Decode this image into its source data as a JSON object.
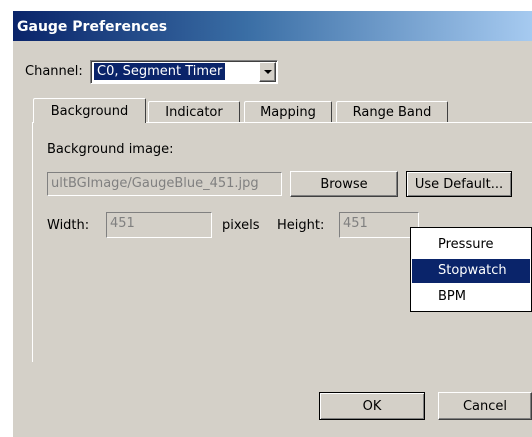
{
  "window": {
    "title": "Gauge Preferences"
  },
  "channel": {
    "label": "Channel:",
    "value": "C0, Segment Timer"
  },
  "tabs": [
    {
      "label": "Background",
      "active": true
    },
    {
      "label": "Indicator"
    },
    {
      "label": "Mapping"
    },
    {
      "label": "Range Band"
    }
  ],
  "background_tab": {
    "image_label": "Background image:",
    "image_path": "ultBGImage/GaugeBlue_451.jpg",
    "browse_label": "Browse",
    "use_default_label": "Use Default...",
    "width_label": "Width:",
    "width_value": "451",
    "pixels_label": "pixels",
    "height_label": "Height:",
    "height_value": "451"
  },
  "default_menu": {
    "items": [
      "Pressure",
      "Stopwatch",
      "BPM"
    ],
    "selected": "Stopwatch"
  },
  "footer": {
    "ok_label": "OK",
    "cancel_label": "Cancel"
  }
}
